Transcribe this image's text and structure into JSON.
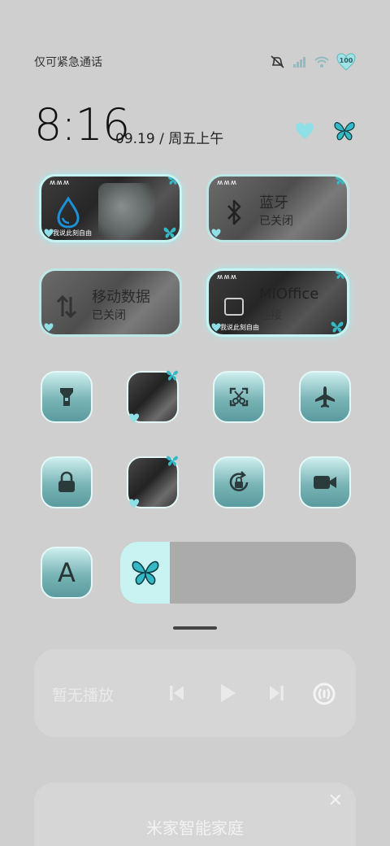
{
  "status": {
    "carrier_text": "仅可紧急通话",
    "battery_level": "100",
    "icons": [
      "mute-icon",
      "signal-icon",
      "wifi-icon",
      "battery-heart-icon"
    ]
  },
  "clock": {
    "time": "8:16",
    "date": "09.19 / 周五上午"
  },
  "tiles": [
    {
      "tag": "ʍʍʍ",
      "caption": "我说此刻自由",
      "title": "",
      "sub": "",
      "icon": "water-drop-icon"
    },
    {
      "tag": "ʍʍʍ",
      "caption": "",
      "title": "蓝牙",
      "sub": "已关闭",
      "icon": "bluetooth-icon"
    },
    {
      "tag": "",
      "caption": "",
      "title": "移动数据",
      "sub": "已关闭",
      "icon": "mobile-data-icon"
    },
    {
      "tag": "ʍʍʍ",
      "caption": "我说此刻自由",
      "title": "MIOffice",
      "sub": "连接",
      "icon": "mioffice-icon"
    }
  ],
  "toggles": [
    "flashlight-icon",
    "photo-toggle",
    "screenshot-icon",
    "airplane-icon",
    "lock-icon",
    "photo-toggle",
    "rotation-lock-icon",
    "video-icon",
    "font-icon"
  ],
  "font_button_label": "A",
  "brightness": {
    "level": 0.21
  },
  "media": {
    "status": "暂无播放"
  },
  "mijia": {
    "title": "米家智能家庭",
    "close": "✕"
  },
  "colors": {
    "accent": "#c9f3f3",
    "teal": "#5a9a9e",
    "background": "#cfcfcf"
  }
}
